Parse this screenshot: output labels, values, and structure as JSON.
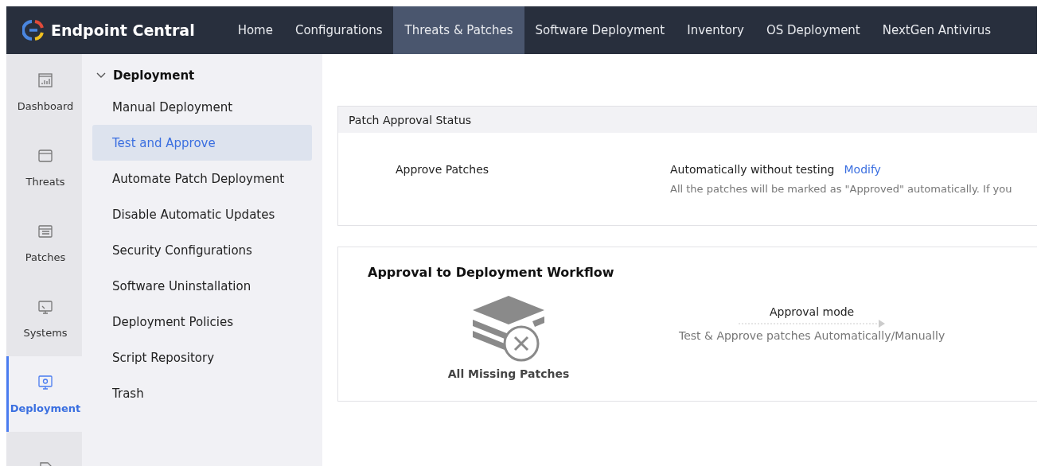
{
  "brand": {
    "name": "Endpoint Central"
  },
  "nav": [
    {
      "label": "Home",
      "selected": false
    },
    {
      "label": "Configurations",
      "selected": false
    },
    {
      "label": "Threats & Patches",
      "selected": true
    },
    {
      "label": "Software Deployment",
      "selected": false
    },
    {
      "label": "Inventory",
      "selected": false
    },
    {
      "label": "OS Deployment",
      "selected": false
    },
    {
      "label": "NextGen Antivirus",
      "selected": false
    }
  ],
  "rail": [
    {
      "kind": "dashboard",
      "label": "Dashboard",
      "selected": false
    },
    {
      "kind": "threats",
      "label": "Threats",
      "selected": false
    },
    {
      "kind": "patches",
      "label": "Patches",
      "selected": false
    },
    {
      "kind": "systems",
      "label": "Systems",
      "selected": false
    },
    {
      "kind": "deployment",
      "label": "Deployment",
      "selected": true
    },
    {
      "kind": "checklist",
      "selected": false
    }
  ],
  "submenu": {
    "title": "Deployment",
    "expanded": true,
    "items": [
      {
        "label": "Manual Deployment",
        "selected": false
      },
      {
        "label": "Test and Approve",
        "selected": true
      },
      {
        "label": "Automate Patch Deployment",
        "selected": false
      },
      {
        "label": "Disable Automatic Updates",
        "selected": false
      },
      {
        "label": "Security Configurations",
        "selected": false
      },
      {
        "label": "Software Uninstallation",
        "selected": false
      },
      {
        "label": "Deployment Policies",
        "selected": false
      },
      {
        "label": "Script Repository",
        "selected": false
      },
      {
        "label": "Trash",
        "selected": false
      }
    ]
  },
  "status_panel": {
    "title": "Patch Approval Status",
    "label": "Approve Patches",
    "value": "Automatically without testing",
    "link": "Modify",
    "note": "All the patches will be marked as \"Approved\" automatically. If you"
  },
  "workflow": {
    "title": "Approval to Deployment Workflow",
    "source": "All Missing Patches",
    "step_title": "Approval mode",
    "step_note": "Test & Approve patches Automatically/Manually"
  }
}
